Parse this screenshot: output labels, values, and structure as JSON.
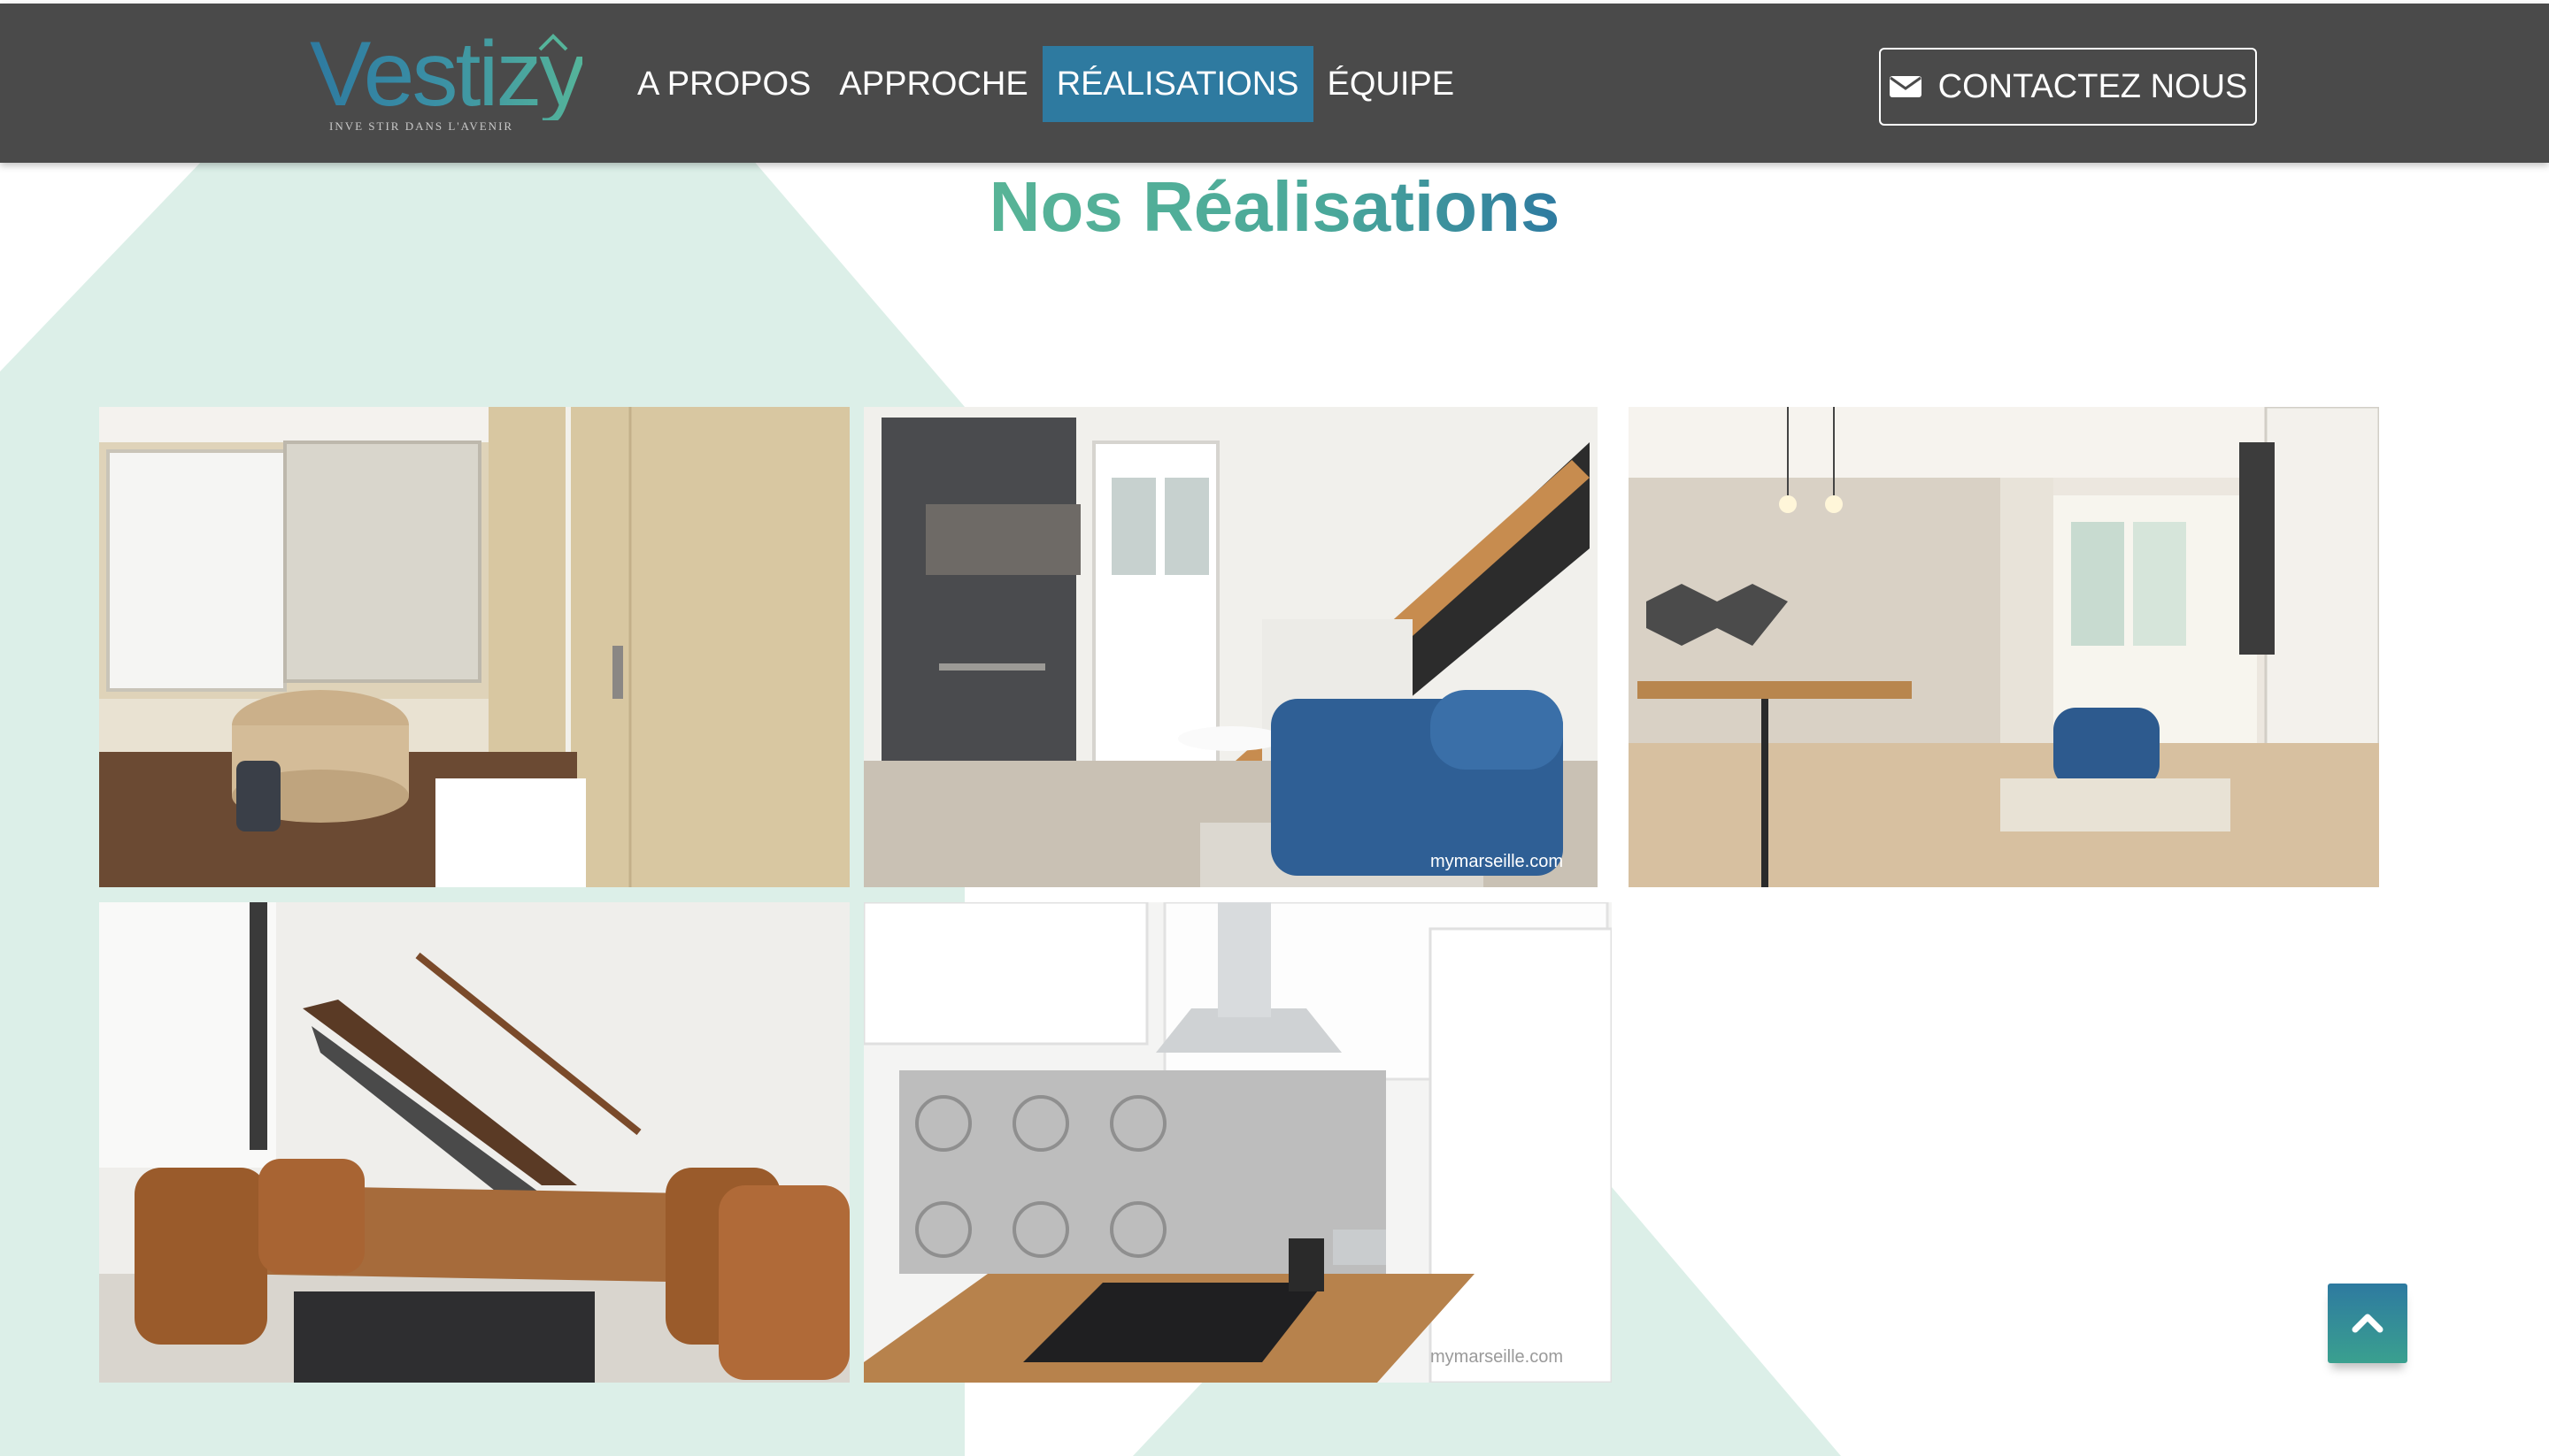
{
  "brand": {
    "name": "Vestizy",
    "tagline": "INVE STIR  DANS  L'AVENIR"
  },
  "nav": {
    "items": [
      {
        "label": "A PROPOS",
        "active": false
      },
      {
        "label": "APPROCHE",
        "active": false
      },
      {
        "label": "RÉALISATIONS",
        "active": true
      },
      {
        "label": "ÉQUIPE",
        "active": false
      }
    ],
    "contact_label": "CONTACTEZ NOUS"
  },
  "page": {
    "title": "Nos Réalisations"
  },
  "gallery": {
    "photos": [
      {
        "subject": "bathroom",
        "watermark": ""
      },
      {
        "subject": "living-room-staircase",
        "watermark": "mymarseille.com"
      },
      {
        "subject": "dining-living-room",
        "watermark": ""
      },
      {
        "subject": "dining-table-staircase",
        "watermark": ""
      },
      {
        "subject": "kitchen",
        "watermark": "mymarseille.com"
      }
    ]
  },
  "colors": {
    "navbar": "#4a4a4a",
    "accent": "#2e7aa0",
    "green": "#58b497",
    "mint": "#dcefe8"
  },
  "icons": {
    "contact": "envelope-icon",
    "scroll_top": "chevron-up-icon"
  }
}
